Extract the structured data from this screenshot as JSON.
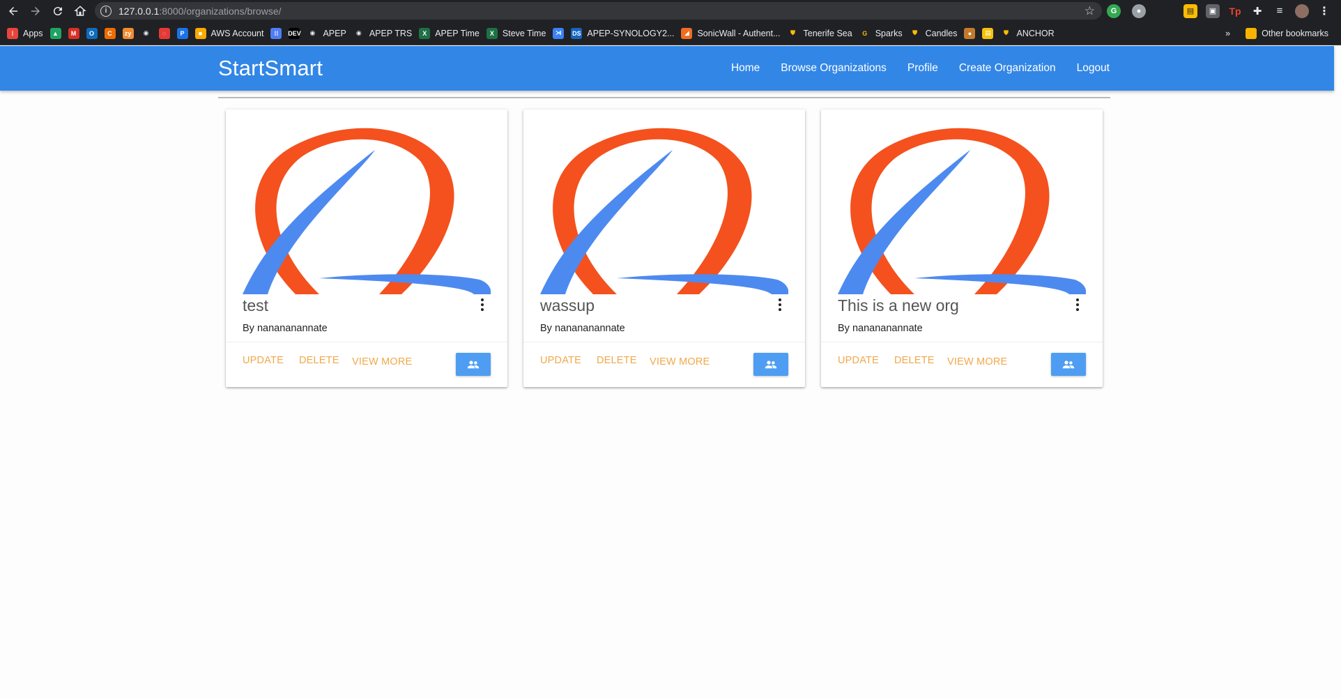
{
  "browser": {
    "url_host": "127.0.0.1",
    "url_rest": ":8000/organizations/browse/",
    "bookmarks": [
      {
        "label": "Apps",
        "icon": "apps-grid-icon",
        "color": "#e8453c"
      },
      {
        "label": "",
        "icon": "google-drive-icon",
        "color": "#1fa463"
      },
      {
        "label": "",
        "icon": "gmail-icon",
        "color": "#d93025"
      },
      {
        "label": "",
        "icon": "outlook-icon",
        "color": "#0f6cbd"
      },
      {
        "label": "",
        "icon": "c-icon",
        "color": "#ef6c00"
      },
      {
        "label": "",
        "icon": "zy-icon",
        "color": "#f28b30"
      },
      {
        "label": "",
        "icon": "globe-icon",
        "color": "#e8eaed"
      },
      {
        "label": "",
        "icon": "loader-icon",
        "color": "#e53935"
      },
      {
        "label": "",
        "icon": "p-icon",
        "color": "#1a73e8"
      },
      {
        "label": "AWS Account",
        "icon": "aws-cube-icon",
        "color": "#f9ab00"
      },
      {
        "label": "",
        "icon": "grid-icon",
        "color": "#4f7df3"
      },
      {
        "label": "",
        "icon": "dev-icon",
        "color": "#000000"
      },
      {
        "label": "APEP",
        "icon": "globe-icon",
        "color": "#e8eaed"
      },
      {
        "label": "APEP TRS",
        "icon": "globe-icon",
        "color": "#e8eaed"
      },
      {
        "label": "APEP Time",
        "icon": "excel-icon",
        "color": "#1e7145"
      },
      {
        "label": "Steve Time",
        "icon": "excel-icon",
        "color": "#1e7145"
      },
      {
        "label": "",
        "icon": "vscode-icon",
        "color": "#3b82f6"
      },
      {
        "label": "APEP-SYNOLOGY2...",
        "icon": "dsm-icon",
        "color": "#1565c0"
      },
      {
        "label": "SonicWall - Authent...",
        "icon": "sonicwall-icon",
        "color": "#f06d22"
      },
      {
        "label": "Tenerife Sea",
        "icon": "shield-icon",
        "color": "#fbbc04"
      },
      {
        "label": "Sparks",
        "icon": "g-icon",
        "color": "#fbbc04"
      },
      {
        "label": "Candles",
        "icon": "shield-icon",
        "color": "#fbbc04"
      },
      {
        "label": "",
        "icon": "cookie-icon",
        "color": "#c47a2c"
      },
      {
        "label": "",
        "icon": "note-icon",
        "color": "#f4c20d"
      },
      {
        "label": "ANCHOR",
        "icon": "shield-icon",
        "color": "#fbbc04"
      }
    ],
    "overflow_label": "»",
    "other_bookmarks": "Other bookmarks"
  },
  "app": {
    "brand": "StartSmart",
    "nav": [
      "Home",
      "Browse Organizations",
      "Profile",
      "Create Organization",
      "Logout"
    ],
    "accent": "#3286e6",
    "action_color": "#f0a84a"
  },
  "organizations": [
    {
      "title": "test",
      "author": "By nanananannate",
      "actions": {
        "update": "UPDATE",
        "delete": "DELETE",
        "view": "VIEW MORE"
      }
    },
    {
      "title": "wassup",
      "author": "By nanananannate",
      "actions": {
        "update": "UPDATE",
        "delete": "DELETE",
        "view": "VIEW MORE"
      }
    },
    {
      "title": "This is a new org",
      "author": "By nanananannate",
      "actions": {
        "update": "UPDATE",
        "delete": "DELETE",
        "view": "VIEW MORE"
      }
    }
  ]
}
